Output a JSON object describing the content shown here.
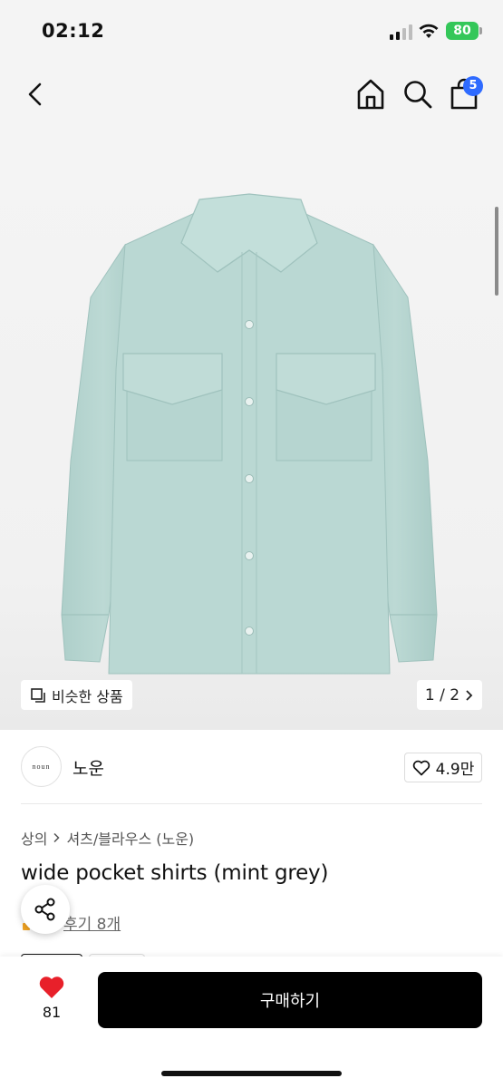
{
  "status_bar": {
    "time": "02:12",
    "battery": "80",
    "battery_color": "#34c759"
  },
  "header": {
    "icons": [
      "back-icon",
      "home-icon",
      "search-icon",
      "shopping-bag-icon"
    ],
    "cart_count": "5",
    "badge_color": "#2f6bff"
  },
  "gallery": {
    "similar_label": "비슷한 상품",
    "page_indicator": "1 / 2",
    "shirt_color": "#b9d6d1"
  },
  "brand": {
    "logo_text": "noun",
    "name": "노운",
    "likes": "4.9만"
  },
  "product": {
    "breadcrumb": [
      "상의",
      "셔츠/블라우스 (노운)"
    ],
    "title": "wide pocket shirts (mint grey)",
    "review_link": "후기 8개"
  },
  "bottom": {
    "wish_count": "81",
    "buy_label": "구매하기",
    "heart_color": "#e8202a"
  }
}
